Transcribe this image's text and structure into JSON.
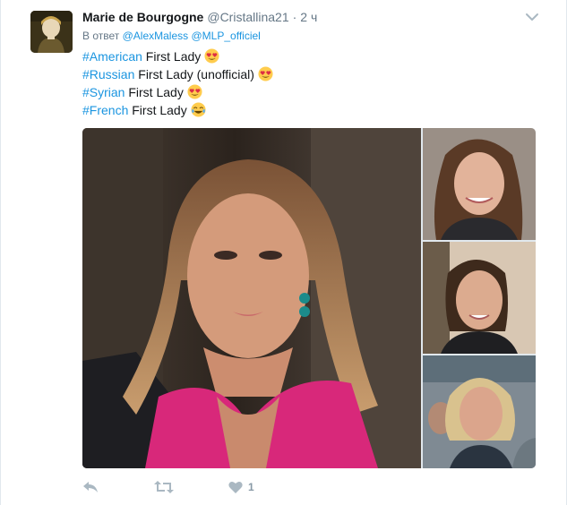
{
  "tweet": {
    "author": {
      "full_name": "Marie de Bourgogne",
      "username": "@Cristallina21",
      "separator": "·",
      "time": "2 ч"
    },
    "reply_to": {
      "prefix": "В ответ",
      "mentions": [
        "@AlexMaless",
        "@MLP_officiel"
      ]
    },
    "lines": [
      {
        "hashtag": "#American",
        "text": " First Lady",
        "emoji": "heart-eyes"
      },
      {
        "hashtag": "#Russian",
        "text": " First Lady (unofficial)",
        "emoji": "heart-eyes"
      },
      {
        "hashtag": "#Syrian",
        "text": " First Lady",
        "emoji": "heart-eyes"
      },
      {
        "hashtag": "#French",
        "text": " First Lady",
        "emoji": "tears-of-joy"
      }
    ],
    "media": {
      "count": 4,
      "layout": "one-large-three-stacked"
    },
    "actions": {
      "reply_icon": "reply-icon",
      "retweet_icon": "retweet-icon",
      "like_icon": "heart-icon",
      "like_count": "1"
    }
  },
  "colors": {
    "link": "#1b95e0",
    "muted": "#657786",
    "action_gray": "#8899a6"
  }
}
